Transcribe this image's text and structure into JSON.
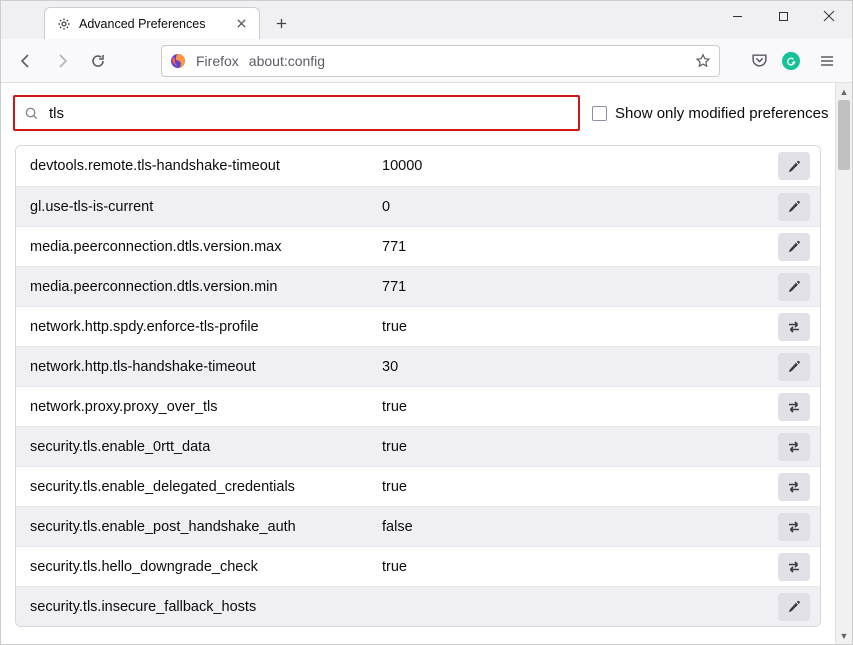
{
  "tab": {
    "title": "Advanced Preferences"
  },
  "addressbar": {
    "identity": "Firefox",
    "url": "about:config"
  },
  "search": {
    "value": "tls",
    "placeholder": ""
  },
  "show_only_label": "Show only modified preferences",
  "prefs": [
    {
      "name": "devtools.remote.tls-handshake-timeout",
      "value": "10000",
      "action": "edit"
    },
    {
      "name": "gl.use-tls-is-current",
      "value": "0",
      "action": "edit"
    },
    {
      "name": "media.peerconnection.dtls.version.max",
      "value": "771",
      "action": "edit"
    },
    {
      "name": "media.peerconnection.dtls.version.min",
      "value": "771",
      "action": "edit"
    },
    {
      "name": "network.http.spdy.enforce-tls-profile",
      "value": "true",
      "action": "toggle"
    },
    {
      "name": "network.http.tls-handshake-timeout",
      "value": "30",
      "action": "edit"
    },
    {
      "name": "network.proxy.proxy_over_tls",
      "value": "true",
      "action": "toggle"
    },
    {
      "name": "security.tls.enable_0rtt_data",
      "value": "true",
      "action": "toggle"
    },
    {
      "name": "security.tls.enable_delegated_credentials",
      "value": "true",
      "action": "toggle"
    },
    {
      "name": "security.tls.enable_post_handshake_auth",
      "value": "false",
      "action": "toggle"
    },
    {
      "name": "security.tls.hello_downgrade_check",
      "value": "true",
      "action": "toggle"
    },
    {
      "name": "security.tls.insecure_fallback_hosts",
      "value": "",
      "action": "edit"
    }
  ]
}
